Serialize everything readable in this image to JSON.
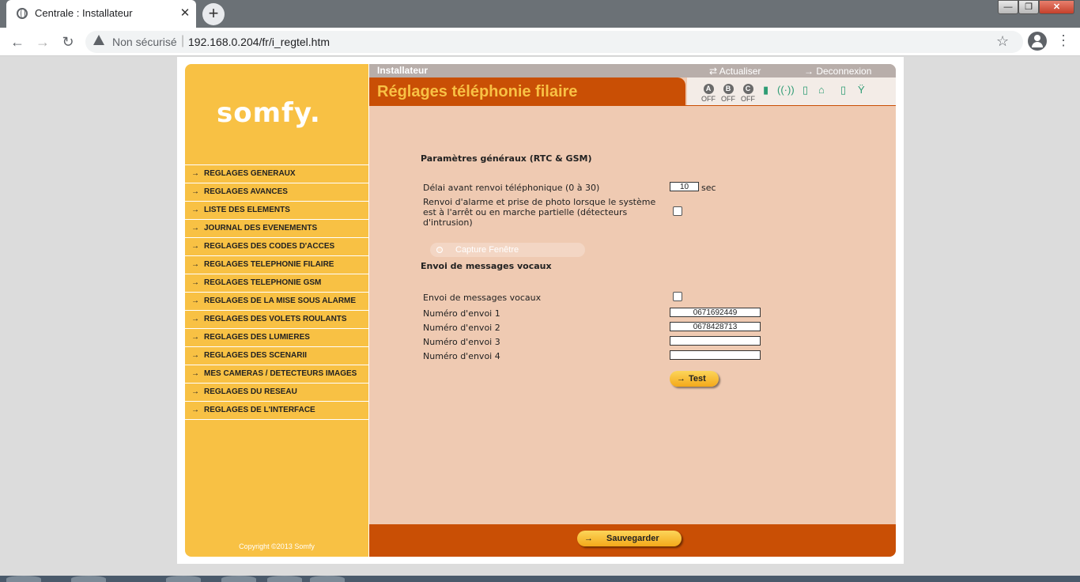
{
  "browser": {
    "tab_title": "Centrale  : Installateur",
    "tab_close": "✕",
    "new_tab": "+",
    "security_label": "Non sécurisé",
    "url": "192.168.0.204/fr/i_regtel.htm",
    "window_min": "—",
    "window_max": "❐",
    "window_close": "✕"
  },
  "brand": {
    "logo": "somfy.",
    "copyright": "Copyright ©2013 Somfy"
  },
  "sidebar": {
    "arrow": "→",
    "items": [
      {
        "label": "REGLAGES GENERAUX"
      },
      {
        "label": "REGLAGES AVANCES"
      },
      {
        "label": "LISTE DES ELEMENTS"
      },
      {
        "label": "JOURNAL DES EVENEMENTS"
      },
      {
        "label": "REGLAGES DES CODES D'ACCES"
      },
      {
        "label": "REGLAGES TELEPHONIE FILAIRE"
      },
      {
        "label": "REGLAGES TELEPHONIE GSM"
      },
      {
        "label": "REGLAGES DE LA MISE SOUS ALARME"
      },
      {
        "label": "REGLAGES DES VOLETS ROULANTS"
      },
      {
        "label": "REGLAGES DES LUMIERES"
      },
      {
        "label": "REGLAGES DES SCENARII"
      },
      {
        "label": "MES CAMERAS / DETECTEURS IMAGES"
      },
      {
        "label": "REGLAGES DU RESEAU"
      },
      {
        "label": "REGLAGES DE L'INTERFACE"
      }
    ]
  },
  "header": {
    "role": "Installateur",
    "refresh": "Actualiser",
    "logout": "Deconnexion",
    "page_title": "Réglages téléphonie filaire",
    "zones": [
      {
        "letter": "A",
        "state": "OFF"
      },
      {
        "letter": "B",
        "state": "OFF"
      },
      {
        "letter": "C",
        "state": "OFF"
      }
    ],
    "status_icons": [
      "battery-icon",
      "signal-icon",
      "device-icon",
      "home-ok-icon",
      "sensor-icon",
      "antenna-icon"
    ]
  },
  "general": {
    "title": "Paramètres généraux (RTC & GSM)",
    "delay_label": "Délai avant renvoi téléphonique (0 à 30)",
    "delay_value": "10",
    "delay_unit": "sec",
    "alarm_label_1": "Renvoi d'alarme et prise de photo lorsque le système",
    "alarm_label_2": "est à l'arrêt ou en marche partielle (détecteurs",
    "alarm_label_3": "d'intrusion)",
    "alarm_checked": false
  },
  "capture_hint": "Capture Fenêtre",
  "voice": {
    "title": "Envoi de messages vocaux",
    "enable_label": "Envoi de messages vocaux",
    "enable_checked": false,
    "numbers": [
      {
        "label": "Numéro d'envoi 1",
        "value": "0671692449"
      },
      {
        "label": "Numéro d'envoi 2",
        "value": "0678428713"
      },
      {
        "label": "Numéro d'envoi 3",
        "value": ""
      },
      {
        "label": "Numéro d'envoi 4",
        "value": ""
      }
    ],
    "test_label": "Test"
  },
  "footer": {
    "save_label": "Sauvegarder"
  },
  "colors": {
    "sidebar": "#f8c144",
    "content": "#efcab2",
    "accent": "#c94f05"
  }
}
